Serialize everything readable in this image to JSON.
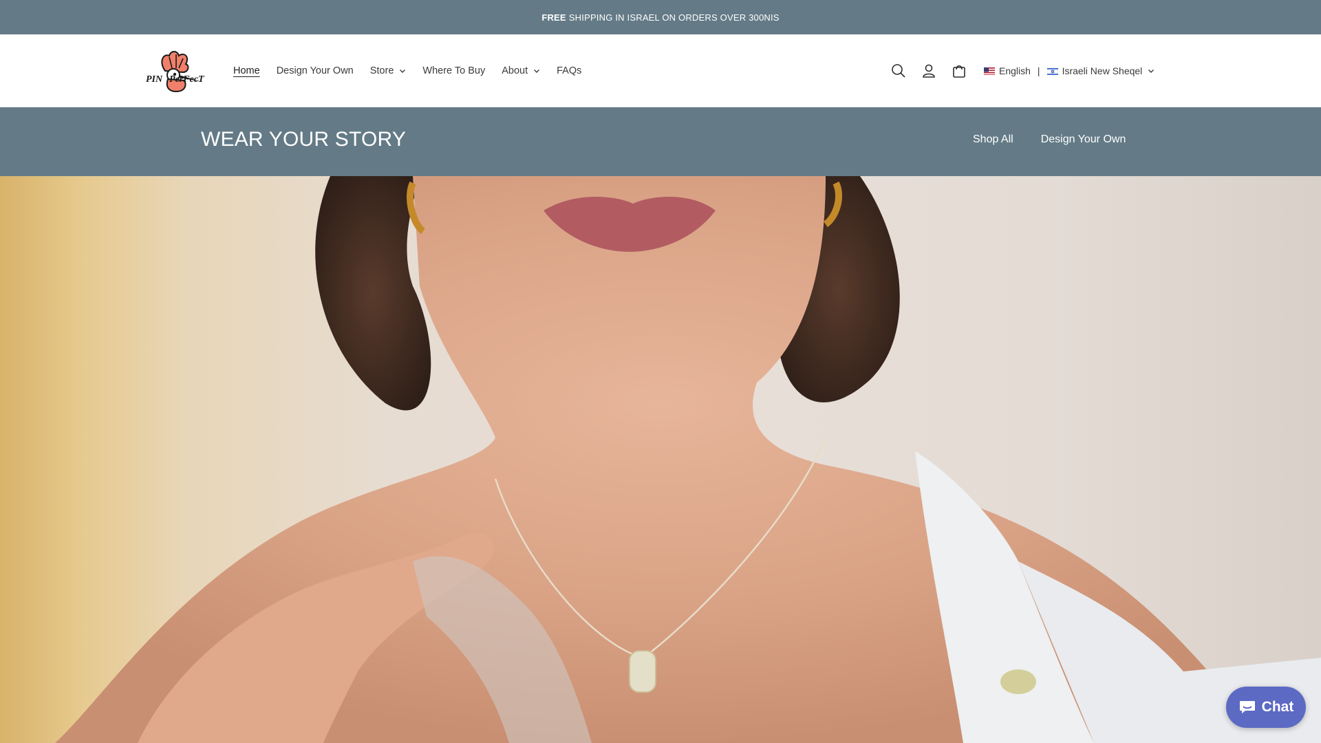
{
  "announcement": {
    "bold": "FREE",
    "text": "SHIPPING IN ISRAEL ON ORDERS OVER 300NIS"
  },
  "header": {
    "logo_text": "Pin Perfect",
    "nav": [
      {
        "label": "Home",
        "active": true,
        "dropdown": false
      },
      {
        "label": "Design Your Own",
        "active": false,
        "dropdown": false
      },
      {
        "label": "Store",
        "active": false,
        "dropdown": true
      },
      {
        "label": "Where To Buy",
        "active": false,
        "dropdown": false
      },
      {
        "label": "About",
        "active": false,
        "dropdown": true
      },
      {
        "label": "FAQs",
        "active": false,
        "dropdown": false
      }
    ],
    "icons": [
      "search-icon",
      "account-icon",
      "cart-icon"
    ],
    "language": "English",
    "currency": "Israeli New Sheqel"
  },
  "banner": {
    "title": "WEAR YOUR STORY",
    "links": [
      "Shop All",
      "Design Your Own"
    ]
  },
  "chat": {
    "label": "Chat"
  },
  "colors": {
    "bar": "#647b87",
    "chat": "#5c6ac4"
  }
}
